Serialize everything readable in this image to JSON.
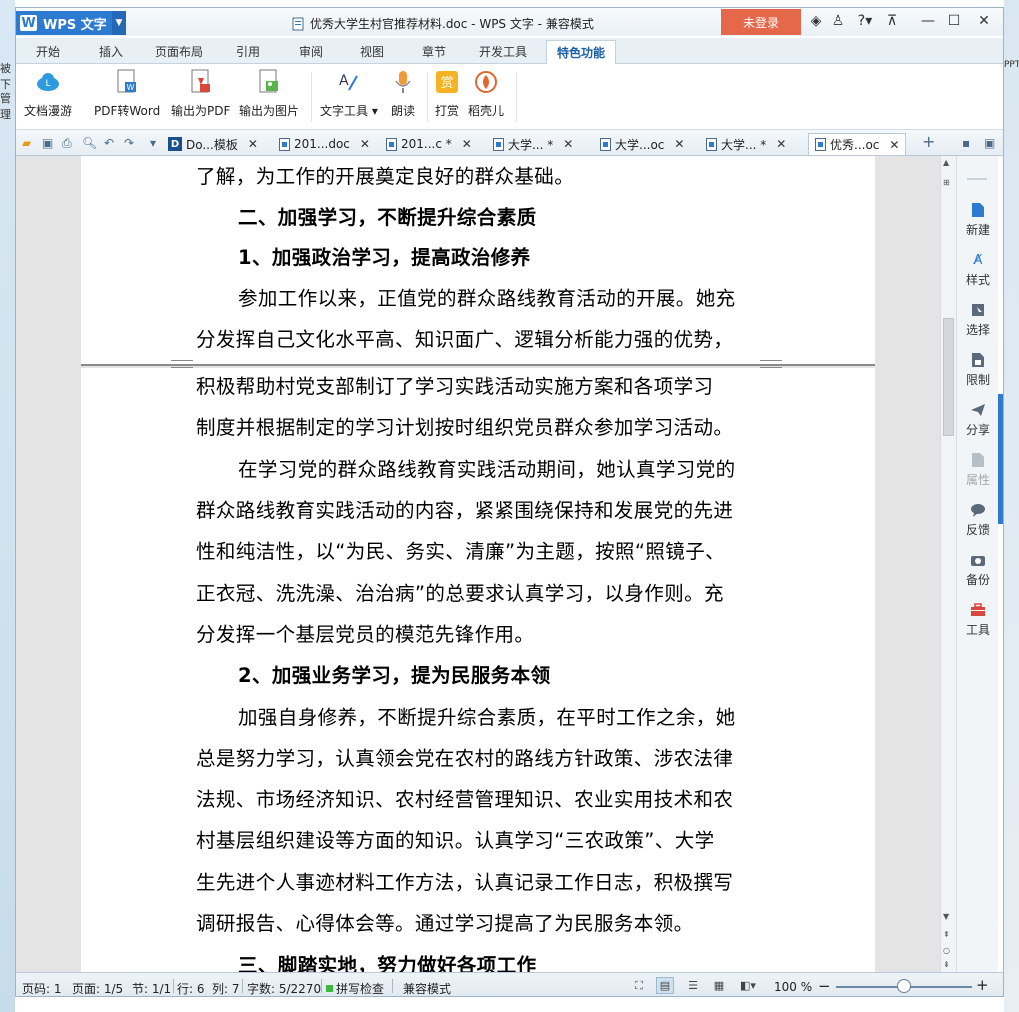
{
  "app": {
    "menu_label": "WPS 文字",
    "window_title": "优秀大学生村官推荐材料.doc - WPS 文字 - 兼容模式",
    "login_label": "未登录"
  },
  "ribbon_tabs": [
    "开始",
    "插入",
    "页面布局",
    "引用",
    "审阅",
    "视图",
    "章节",
    "开发工具",
    "特色功能"
  ],
  "ribbon_buttons": [
    "文档漫游",
    "PDF转Word",
    "输出为PDF",
    "输出为图片",
    "文字工具 ▾",
    "朗读",
    "打赏",
    "稻壳儿"
  ],
  "doc_tabs": [
    "Do...模板",
    "201...doc",
    "201...c *",
    "大学... *",
    "大学...oc",
    "大学... *",
    "优秀...oc"
  ],
  "page1_lines": [
    "了解，为工作的开展奠定良好的群众基础。",
    "二、加强学习，不断提升综合素质",
    "1、加强政治学习，提高政治修养",
    "参加工作以来，正值党的群众路线教育活动的开展。她充",
    "分发挥自己文化水平高、知识面广、逻辑分析能力强的优势，"
  ],
  "page2_lines": [
    "积极帮助村党支部制订了学习实践活动实施方案和各项学习",
    "制度并根据制定的学习计划按时组织党员群众参加学习活动。",
    "在学习党的群众路线教育实践活动期间，她认真学习党的",
    "群众路线教育实践活动的内容，紧紧围绕保持和发展党的先进",
    "性和纯洁性，以“为民、务实、清廉”为主题，按照“照镜子、",
    "正衣冠、洗洗澡、治治病”的总要求认真学习，以身作则。充",
    "分发挥一个基层党员的模范先锋作用。",
    "2、加强业务学习，提为民服务本领",
    "加强自身修养，不断提升综合素质，在平时工作之余，她",
    "总是努力学习，认真领会党在农村的路线方针政策、涉农法律",
    "法规、市场经济知识、农村经营管理知识、农业实用技术和农",
    "村基层组织建设等方面的知识。认真学习“三农政策”、大学",
    "生先进个人事迹材料工作方法，认真记录工作日志，积极撰写",
    "调研报告、心得体会等。通过学习提高了为民服务本领。",
    "三、脚踏实地，努力做好各项工作"
  ],
  "right_panel": [
    "新建",
    "样式",
    "选择",
    "限制",
    "分享",
    "属性",
    "反馈",
    "备份",
    "工具"
  ],
  "status": {
    "page_code": "页码: 1",
    "page": "页面: 1/5",
    "section": "节: 1/1",
    "row": "行: 6",
    "col": "列: 7",
    "words": "字数: 5/2270",
    "spell": "拼写检查",
    "compat": "兼容模式",
    "zoom": "100 %",
    "zoom_fraction": 0.5
  },
  "ghost_text": {
    "left_a": "被下",
    "left_b": "管理",
    "right_a": "PPT"
  },
  "colors": {
    "accent": "#2d7bd0",
    "login": "#e6684a",
    "spell_ok": "#3cba3c"
  }
}
